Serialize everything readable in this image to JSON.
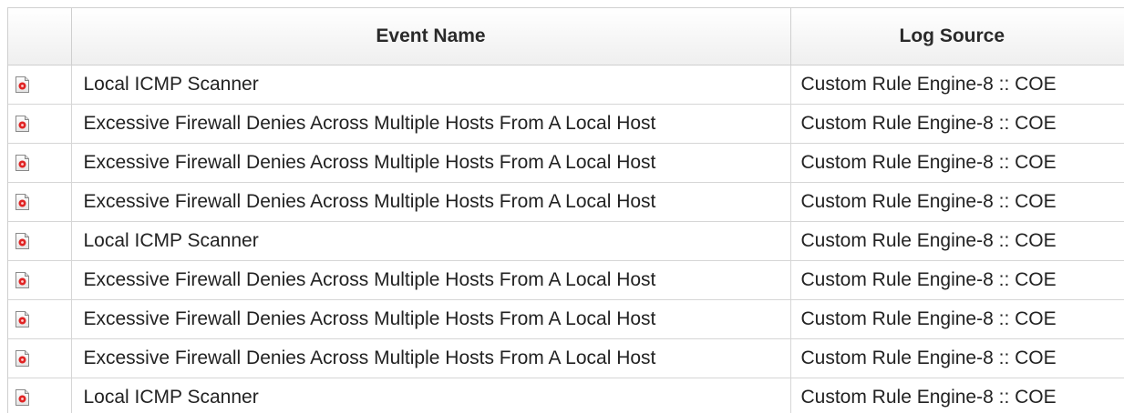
{
  "table": {
    "columns": {
      "event_name": "Event Name",
      "log_source": "Log Source"
    },
    "row_icon": "offense-document-icon",
    "accent_color": "#e02424",
    "rows": [
      {
        "event_name": "Local ICMP Scanner",
        "log_source": "Custom Rule Engine-8 :: COE"
      },
      {
        "event_name": "Excessive Firewall Denies Across Multiple Hosts From A Local Host",
        "log_source": "Custom Rule Engine-8 :: COE"
      },
      {
        "event_name": "Excessive Firewall Denies Across Multiple Hosts From A Local Host",
        "log_source": "Custom Rule Engine-8 :: COE"
      },
      {
        "event_name": "Excessive Firewall Denies Across Multiple Hosts From A Local Host",
        "log_source": "Custom Rule Engine-8 :: COE"
      },
      {
        "event_name": "Local ICMP Scanner",
        "log_source": "Custom Rule Engine-8 :: COE"
      },
      {
        "event_name": "Excessive Firewall Denies Across Multiple Hosts From A Local Host",
        "log_source": "Custom Rule Engine-8 :: COE"
      },
      {
        "event_name": "Excessive Firewall Denies Across Multiple Hosts From A Local Host",
        "log_source": "Custom Rule Engine-8 :: COE"
      },
      {
        "event_name": "Excessive Firewall Denies Across Multiple Hosts From A Local Host",
        "log_source": "Custom Rule Engine-8 :: COE"
      },
      {
        "event_name": "Local ICMP Scanner",
        "log_source": "Custom Rule Engine-8 :: COE"
      }
    ]
  }
}
